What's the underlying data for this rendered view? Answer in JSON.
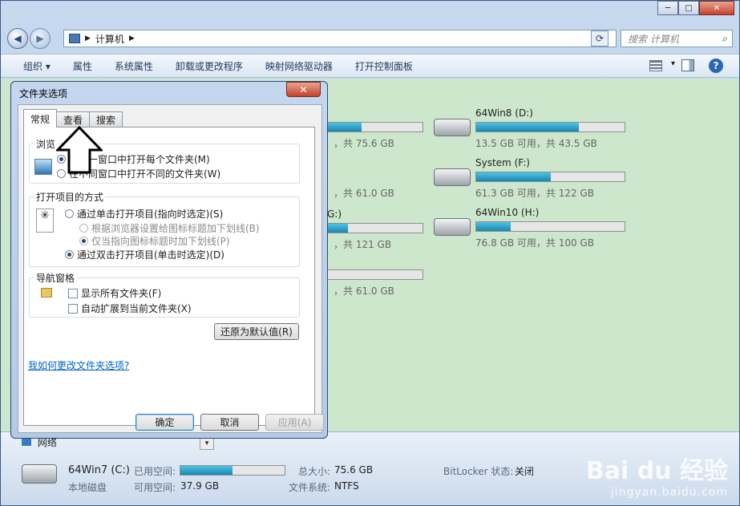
{
  "window": {
    "min": "─",
    "max": "□",
    "close": "✕"
  },
  "address": {
    "path_root": "▶",
    "location": "计算机",
    "sep": "▶",
    "search_placeholder": "搜索 计算机"
  },
  "toolbar": {
    "items": [
      "组织 ▾",
      "属性",
      "系统属性",
      "卸载或更改程序",
      "映射网络驱动器",
      "打开控制面板"
    ]
  },
  "drives": [
    {
      "name": "",
      "size": "，共 75.6 GB",
      "fill": 0.55
    },
    {
      "name": "64Win8  (D:)",
      "size": "13.5 GB 可用，共 43.5 GB",
      "fill": 0.69
    },
    {
      "name": "",
      "size": "，共 61.0 GB",
      "fill": 0.0
    },
    {
      "name": "System (F:)",
      "size": "61.3 GB 可用，共 122 GB",
      "fill": 0.5
    },
    {
      "name": "G:)",
      "size": "，共 121 GB",
      "fill": 0.45
    },
    {
      "name": "64Win10 (H:)",
      "size": "76.8 GB 可用，共 100 GB",
      "fill": 0.23
    },
    {
      "name": "",
      "size": "，共 61.0 GB",
      "fill": 0.0
    }
  ],
  "details": {
    "network": "网络",
    "drive_name": "64Win7  (C:)",
    "drive_type": "本地磁盘",
    "used_label": "已用空间:",
    "free_label": "可用空间:",
    "free_value": "37.9 GB",
    "total_label": "总大小:",
    "total_value": "75.6 GB",
    "fs_label": "文件系统:",
    "fs_value": "NTFS",
    "bitlocker_label": "BitLocker 状态:",
    "bitlocker_value": "关闭",
    "used_fill": 0.5
  },
  "dialog": {
    "title": "文件夹选项",
    "close": "✕",
    "tabs": [
      "常规",
      "查看",
      "搜索"
    ],
    "browse_group": "浏览",
    "browse_opt1": "在同一窗口中打开每个文件夹(M)",
    "browse_opt2": "在不同窗口中打开不同的文件夹(W)",
    "click_group": "打开项目的方式",
    "click_opt1": "通过单击打开项目(指向时选定)(S)",
    "click_sub1": "根据浏览器设置给图标标题加下划线(B)",
    "click_sub2": "仅当指向图标标题时加下划线(P)",
    "click_opt2": "通过双击打开项目(单击时选定)(D)",
    "nav_group": "导航窗格",
    "nav_opt1": "显示所有文件夹(F)",
    "nav_opt2": "自动扩展到当前文件夹(X)",
    "restore": "还原为默认值(R)",
    "help_link": "我如何更改文件夹选项?",
    "ok": "确定",
    "cancel": "取消",
    "apply": "应用(A)"
  },
  "watermark": {
    "brand": "Bai du 经验",
    "url": "jingyan.baidu.com"
  }
}
